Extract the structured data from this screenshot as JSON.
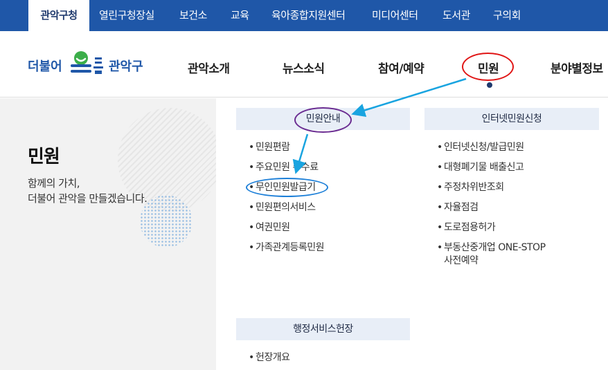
{
  "topbar": {
    "tabs": [
      {
        "label": "관악구청",
        "active": true
      },
      {
        "label": "열린구청장실"
      },
      {
        "label": "보건소"
      },
      {
        "label": "교육"
      },
      {
        "label": "육아종합지원센터"
      },
      {
        "label": "미디어센터"
      },
      {
        "label": "도서관"
      },
      {
        "label": "구의회"
      }
    ]
  },
  "header": {
    "logo": {
      "text_left": "더불어",
      "text_right": "관악구"
    },
    "nav": [
      "관악소개",
      "뉴스소식",
      "참여/예약",
      "민원",
      "분야별정보"
    ]
  },
  "left": {
    "title": "민원",
    "desc_line1": "함께의 가치,",
    "desc_line2": "더불어 관악을 만들겠습니다."
  },
  "columns": {
    "col1": {
      "heading": "민원안내",
      "items": [
        "민원편람",
        "주요민원 수수료",
        "무인민원발급기",
        "민원편의서비스",
        "여권민원",
        "가족관계등록민원"
      ]
    },
    "col2": {
      "heading": "인터넷민원신청",
      "items": [
        "인터넷신청/발급민원",
        "대형폐기물 배출신고",
        "주정차위반조회",
        "자율점검",
        "도로점용허가",
        "부동산중개업 ONE-STOP",
        "사전예약"
      ]
    },
    "col3": {
      "heading": "행정서비스헌장",
      "items": [
        "헌장개요"
      ]
    }
  },
  "colors": {
    "primary": "#1f57a8",
    "annotation_red": "#e01515",
    "annotation_purple": "#6a2c91",
    "annotation_blue": "#1c7fd8",
    "arrow": "#19a4e0"
  }
}
